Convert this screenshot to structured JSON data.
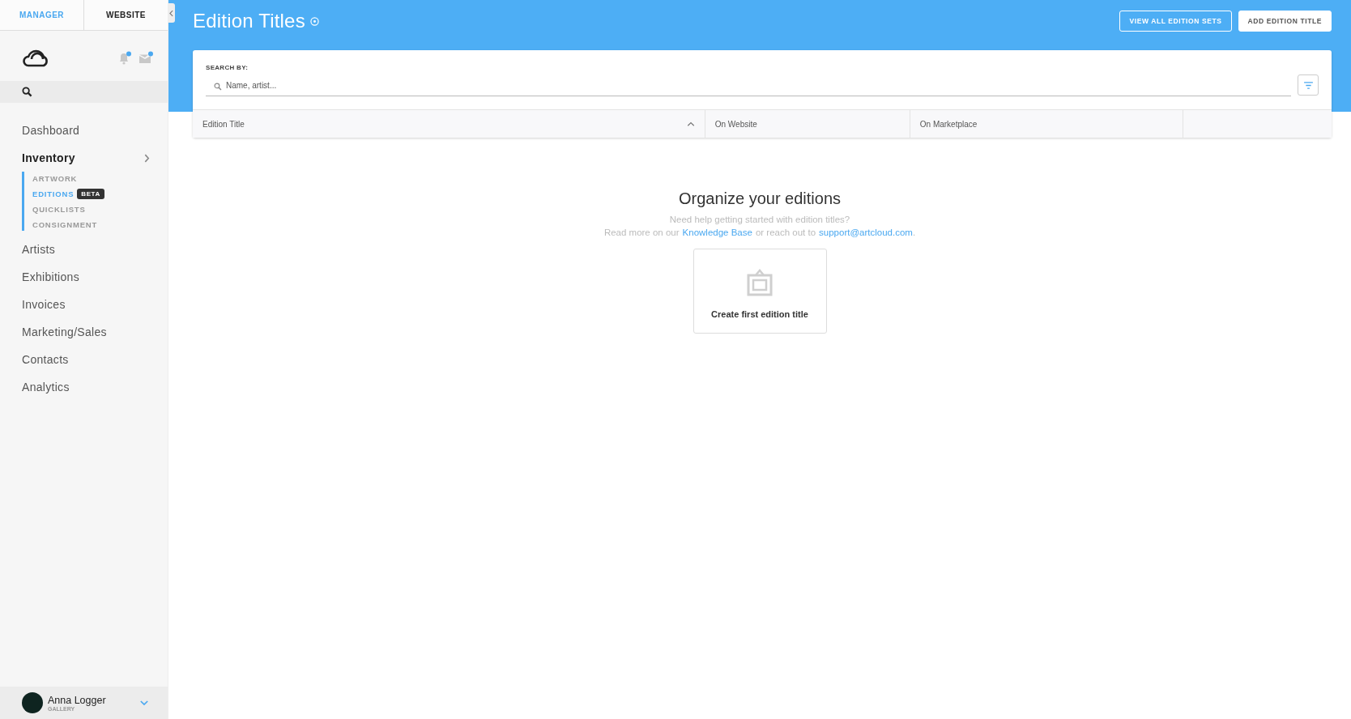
{
  "sidebar": {
    "tabs": [
      {
        "label": "MANAGER",
        "selected": true
      },
      {
        "label": "WEBSITE",
        "selected": false
      }
    ],
    "nav": [
      {
        "label": "Dashboard",
        "selected": false
      },
      {
        "label": "Inventory",
        "selected": true,
        "expanded": true,
        "children": [
          {
            "label": "ARTWORK",
            "selected": false
          },
          {
            "label": "EDITIONS",
            "selected": true,
            "badge": "BETA"
          },
          {
            "label": "QUICKLISTS",
            "selected": false
          },
          {
            "label": "CONSIGNMENT",
            "selected": false
          }
        ]
      },
      {
        "label": "Artists",
        "selected": false
      },
      {
        "label": "Exhibitions",
        "selected": false
      },
      {
        "label": "Invoices",
        "selected": false
      },
      {
        "label": "Marketing/Sales",
        "selected": false
      },
      {
        "label": "Contacts",
        "selected": false
      },
      {
        "label": "Analytics",
        "selected": false
      }
    ],
    "user": {
      "name": "Anna Logger",
      "role": "GALLERY"
    }
  },
  "header": {
    "title": "Edition Titles",
    "buttons": [
      {
        "label": "VIEW ALL EDITION SETS",
        "kind": "outline"
      },
      {
        "label": "ADD EDITION TITLE",
        "kind": "solid"
      }
    ]
  },
  "search": {
    "label": "SEARCH BY:",
    "placeholder": "Name, artist..."
  },
  "table": {
    "columns": [
      {
        "label": "Edition Title",
        "sorted": true
      },
      {
        "label": "On Website",
        "sorted": false
      },
      {
        "label": "On Marketplace",
        "sorted": false
      }
    ]
  },
  "empty_state": {
    "title": "Organize your editions",
    "line_1": "Need help getting started with edition titles?",
    "line_2_before": "Read more on our",
    "link_1": "Knowledge Base",
    "line_2_middle": "or reach out to",
    "link_2": "support@artcloud.com",
    "line_2_after": ".",
    "action": "Create first edition title"
  }
}
